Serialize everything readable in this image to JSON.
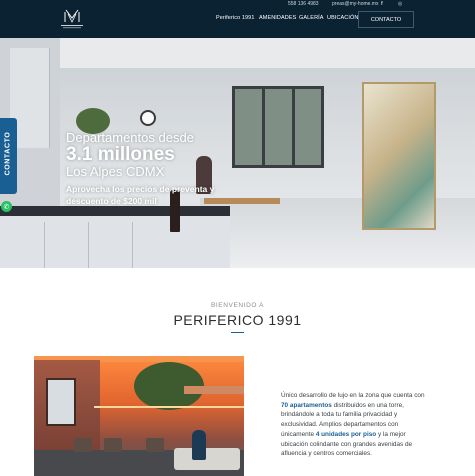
{
  "colors": {
    "brand_dark": "#0b2233",
    "accent_blue": "#1a5f93",
    "whatsapp_green": "#25c163"
  },
  "header": {
    "phone": "558 136 4983",
    "email": "preas@my-home.mx",
    "social": [
      {
        "name": "facebook-icon",
        "glyph": "f"
      },
      {
        "name": "instagram-icon",
        "glyph": "◎"
      }
    ],
    "logo_alt_text": "PERIFERICO 1991",
    "nav": [
      "Periferico 1991",
      "AMENIDADES",
      "GALERÍA",
      "UBICACIÓN"
    ],
    "contact_button": "CONTACTO"
  },
  "hero": {
    "line1": "Departamentos desde",
    "line2": "3.1 millones",
    "line3": "Los Alpes CDMX",
    "promo": "Aprovecha los precios de preventa y descuento de $200 mil"
  },
  "side_tab": {
    "label": "CONTACTO",
    "whatsapp_icon": "whatsapp-icon",
    "whatsapp_glyph": "✆"
  },
  "intro": {
    "welcome": "BIENVENIDO A",
    "title": "PERIFERICO 1991",
    "desc": {
      "p1": "Único desarrollo de lujo en la zona que cuenta con ",
      "b1": "70 apartamentos",
      "p2": " distribuidos en una torre, brindándole a toda tu familia privacidad y exclusividad. Amplios departamentos con únicamente ",
      "b2": "4 unidades por piso",
      "p3": " y la mejor ubicación colindante con grandes avenidas de afluencia y centros comerciales."
    }
  }
}
